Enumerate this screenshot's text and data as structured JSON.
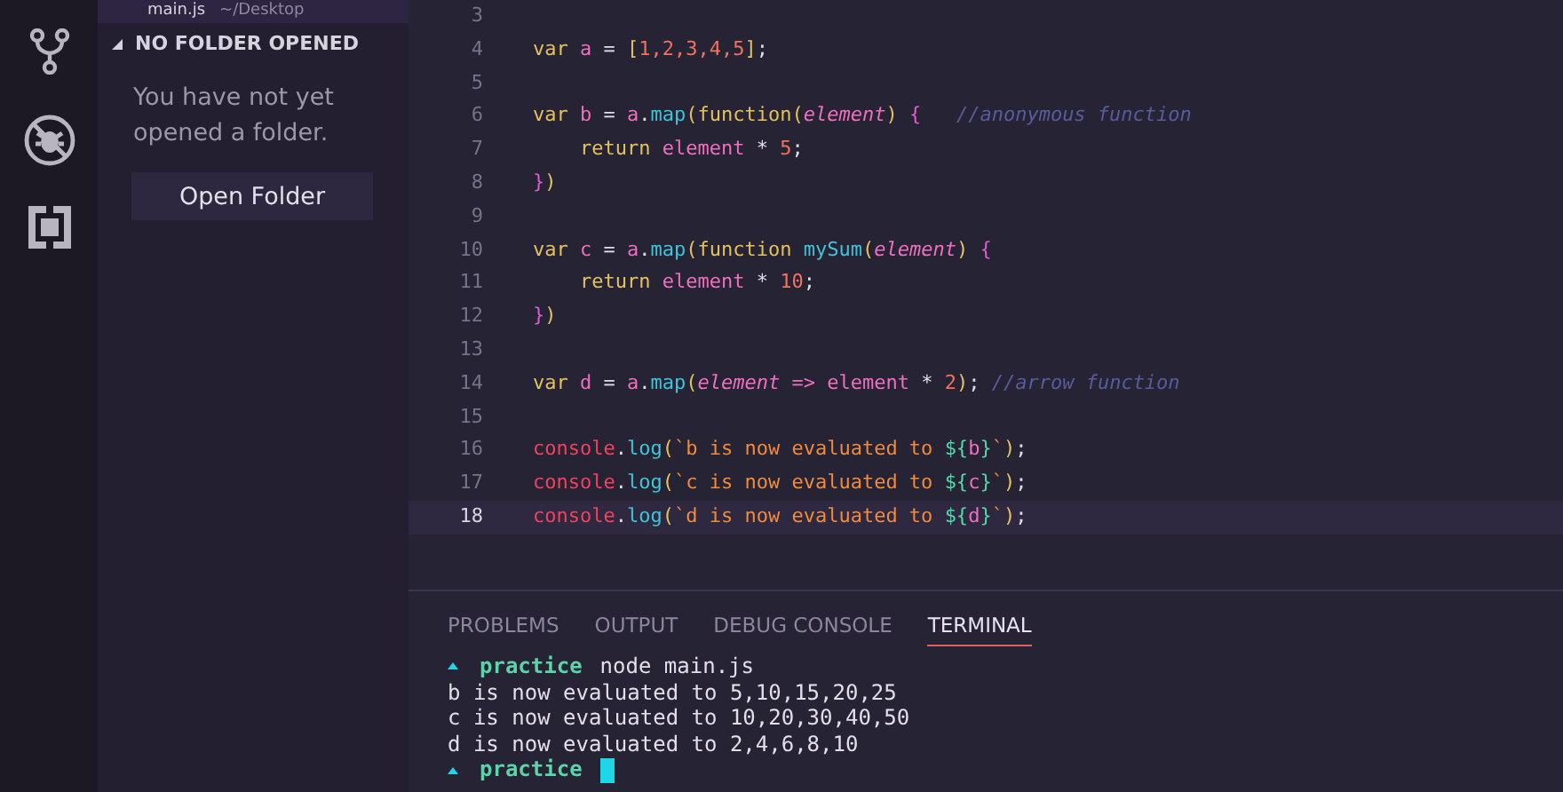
{
  "open_editor": {
    "file": "main.js",
    "path": "~/Desktop"
  },
  "sidebar": {
    "section_title": "NO FOLDER OPENED",
    "expanded": true,
    "message": "You have not yet opened a folder.",
    "button": "Open Folder"
  },
  "activity_bar": [
    {
      "kind": "source-control"
    },
    {
      "kind": "debug"
    },
    {
      "kind": "extensions"
    }
  ],
  "editor": {
    "lines": [
      {
        "number": "3",
        "selected": false
      },
      {
        "number": "4",
        "selected": false,
        "tokens": [
          {
            "text": "var",
            "kind": "keyword"
          },
          {
            "text": " a",
            "kind": "variable"
          },
          {
            "text": " = ",
            "kind": "plain"
          },
          {
            "text": "[",
            "kind": "bracket"
          },
          {
            "text": "1,2,3,4,5",
            "kind": "number"
          },
          {
            "text": "]",
            "kind": "bracket"
          },
          {
            "text": ";",
            "kind": "plain"
          }
        ]
      },
      {
        "number": "5",
        "selected": false
      },
      {
        "number": "6",
        "selected": false,
        "tokens": [
          {
            "text": "var",
            "kind": "keyword"
          },
          {
            "text": " b",
            "kind": "variable"
          },
          {
            "text": " = ",
            "kind": "plain"
          },
          {
            "text": "a",
            "kind": "variable"
          },
          {
            "text": ".",
            "kind": "plain"
          },
          {
            "text": "map",
            "kind": "method"
          },
          {
            "text": "(",
            "kind": "bracket"
          },
          {
            "text": "function",
            "kind": "keyword"
          },
          {
            "text": "(",
            "kind": "bracket"
          },
          {
            "text": "element",
            "kind": "param"
          },
          {
            "text": ") ",
            "kind": "bracket"
          },
          {
            "text": "{",
            "kind": "brace"
          },
          {
            "text": "   //anonymous function",
            "kind": "comment"
          }
        ]
      },
      {
        "number": "7",
        "selected": false,
        "tokens": [
          {
            "text": "    return",
            "kind": "keyword"
          },
          {
            "text": " element",
            "kind": "variable"
          },
          {
            "text": " * ",
            "kind": "plain"
          },
          {
            "text": "5",
            "kind": "number"
          },
          {
            "text": ";",
            "kind": "plain"
          }
        ]
      },
      {
        "number": "8",
        "selected": false,
        "tokens": [
          {
            "text": "}",
            "kind": "brace"
          },
          {
            "text": ")",
            "kind": "bracket"
          }
        ]
      },
      {
        "number": "9",
        "selected": false
      },
      {
        "number": "10",
        "selected": false,
        "tokens": [
          {
            "text": "var",
            "kind": "keyword"
          },
          {
            "text": " c",
            "kind": "variable"
          },
          {
            "text": " = ",
            "kind": "plain"
          },
          {
            "text": "a",
            "kind": "variable"
          },
          {
            "text": ".",
            "kind": "plain"
          },
          {
            "text": "map",
            "kind": "method"
          },
          {
            "text": "(",
            "kind": "bracket"
          },
          {
            "text": "function ",
            "kind": "keyword"
          },
          {
            "text": "mySum",
            "kind": "method"
          },
          {
            "text": "(",
            "kind": "bracket"
          },
          {
            "text": "element",
            "kind": "param"
          },
          {
            "text": ") ",
            "kind": "bracket"
          },
          {
            "text": "{",
            "kind": "brace"
          }
        ]
      },
      {
        "number": "11",
        "selected": false,
        "tokens": [
          {
            "text": "    return",
            "kind": "keyword"
          },
          {
            "text": " element",
            "kind": "variable"
          },
          {
            "text": " * ",
            "kind": "plain"
          },
          {
            "text": "10",
            "kind": "number"
          },
          {
            "text": ";",
            "kind": "plain"
          }
        ]
      },
      {
        "number": "12",
        "selected": false,
        "tokens": [
          {
            "text": "}",
            "kind": "brace"
          },
          {
            "text": ")",
            "kind": "bracket"
          }
        ]
      },
      {
        "number": "13",
        "selected": false
      },
      {
        "number": "14",
        "selected": false,
        "tokens": [
          {
            "text": "var",
            "kind": "keyword"
          },
          {
            "text": " d",
            "kind": "variable"
          },
          {
            "text": " = ",
            "kind": "plain"
          },
          {
            "text": "a",
            "kind": "variable"
          },
          {
            "text": ".",
            "kind": "plain"
          },
          {
            "text": "map",
            "kind": "method"
          },
          {
            "text": "(",
            "kind": "bracket"
          },
          {
            "text": "element",
            "kind": "param"
          },
          {
            "text": " => ",
            "kind": "variable"
          },
          {
            "text": "element",
            "kind": "variable"
          },
          {
            "text": " * ",
            "kind": "plain"
          },
          {
            "text": "2",
            "kind": "number"
          },
          {
            "text": ")",
            "kind": "bracket"
          },
          {
            "text": "; ",
            "kind": "plain"
          },
          {
            "text": "//arrow function",
            "kind": "comment"
          }
        ]
      },
      {
        "number": "15",
        "selected": false
      },
      {
        "number": "16",
        "selected": false,
        "tokens": [
          {
            "text": "console",
            "kind": "object"
          },
          {
            "text": ".",
            "kind": "plain"
          },
          {
            "text": "log",
            "kind": "method"
          },
          {
            "text": "(",
            "kind": "bracket"
          },
          {
            "text": "`b is now evaluated to ",
            "kind": "string"
          },
          {
            "text": "${",
            "kind": "template"
          },
          {
            "text": "b",
            "kind": "variable"
          },
          {
            "text": "}",
            "kind": "template"
          },
          {
            "text": "`",
            "kind": "string"
          },
          {
            "text": ")",
            "kind": "bracket"
          },
          {
            "text": ";",
            "kind": "plain"
          }
        ]
      },
      {
        "number": "17",
        "selected": false,
        "tokens": [
          {
            "text": "console",
            "kind": "object"
          },
          {
            "text": ".",
            "kind": "plain"
          },
          {
            "text": "log",
            "kind": "method"
          },
          {
            "text": "(",
            "kind": "bracket"
          },
          {
            "text": "`c is now evaluated to ",
            "kind": "string"
          },
          {
            "text": "${",
            "kind": "template"
          },
          {
            "text": "c",
            "kind": "variable"
          },
          {
            "text": "}",
            "kind": "template"
          },
          {
            "text": "`",
            "kind": "string"
          },
          {
            "text": ")",
            "kind": "bracket"
          },
          {
            "text": ";",
            "kind": "plain"
          }
        ]
      },
      {
        "number": "18",
        "selected": true,
        "tokens": [
          {
            "text": "console",
            "kind": "object"
          },
          {
            "text": ".",
            "kind": "plain"
          },
          {
            "text": "log",
            "kind": "method"
          },
          {
            "text": "(",
            "kind": "bracket"
          },
          {
            "text": "`d is now evaluated to ",
            "kind": "string"
          },
          {
            "text": "${",
            "kind": "template"
          },
          {
            "text": "d",
            "kind": "variable"
          },
          {
            "text": "}",
            "kind": "template"
          },
          {
            "text": "`",
            "kind": "string"
          },
          {
            "text": ")",
            "kind": "bracket"
          },
          {
            "text": ";",
            "kind": "plain"
          }
        ]
      }
    ]
  },
  "panel": {
    "tabs": [
      {
        "label": "PROBLEMS",
        "selected": false
      },
      {
        "label": "OUTPUT",
        "selected": false
      },
      {
        "label": "DEBUG CONSOLE",
        "selected": false
      },
      {
        "label": "TERMINAL",
        "selected": true
      }
    ],
    "terminal": [
      {
        "kind": "prompt",
        "dir": "practice",
        "command": "node main.js"
      },
      {
        "kind": "output",
        "text": "b is now evaluated to 5,10,15,20,25"
      },
      {
        "kind": "output",
        "text": "c is now evaluated to 10,20,30,40,50"
      },
      {
        "kind": "output",
        "text": "d is now evaluated to 2,4,6,8,10"
      },
      {
        "kind": "prompt",
        "dir": "practice",
        "cursor": true
      }
    ]
  }
}
